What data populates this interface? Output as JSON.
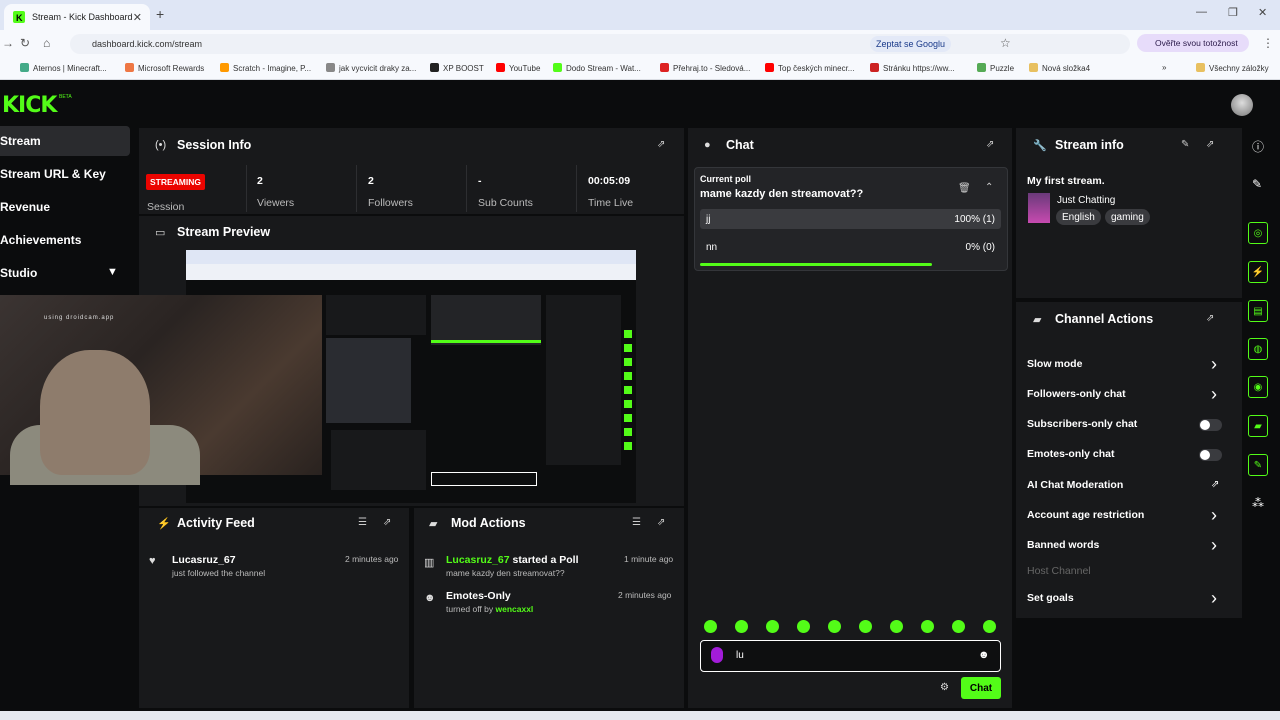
{
  "browser": {
    "tab_title": "Stream - Kick Dashboard",
    "url": "dashboard.kick.com/stream",
    "translate_label": "Zeptat se Googlu",
    "profile_label": "Ověřte svou totožnost",
    "bookmarks": [
      "Aternos | Minecraft...",
      "Microsoft Rewards",
      "Scratch - Imagine, P...",
      "jak vycvicit draky za...",
      "XP BOOST",
      "YouTube",
      "Dodo Stream - Wat...",
      "Přehraj.to - Sledová...",
      "Top českých minecr...",
      "Stránku https://ww...",
      "Puzzle",
      "Nová složka4"
    ],
    "bookmarks_all": "Všechny záložky"
  },
  "header": {
    "logo": "KICK",
    "beta": "BETA"
  },
  "sidebar": {
    "items": [
      {
        "label": "Stream"
      },
      {
        "label": "Stream URL & Key"
      },
      {
        "label": "Revenue"
      },
      {
        "label": "Achievements"
      },
      {
        "label": "Studio"
      }
    ]
  },
  "session": {
    "title": "Session Info",
    "badge": "STREAMING",
    "session_label": "Session",
    "stats": [
      {
        "value": "2",
        "label": "Viewers"
      },
      {
        "value": "2",
        "label": "Followers"
      },
      {
        "value": "-",
        "label": "Sub Counts"
      },
      {
        "value": "00:05:09",
        "label": "Time Live"
      }
    ]
  },
  "preview": {
    "title": "Stream Preview",
    "cam_text": "using droidcam.app"
  },
  "activity": {
    "title": "Activity Feed",
    "items": [
      {
        "user": "Lucasruz_67",
        "text": "just followed the channel",
        "time": "2 minutes ago"
      }
    ]
  },
  "mod": {
    "title": "Mod Actions",
    "items": [
      {
        "user": "Lucasruz_67",
        "action": "started a Poll",
        "sub": "mame kazdy den streamovat??",
        "time": "1 minute ago"
      },
      {
        "title": "Emotes-Only",
        "sub": "turned off by",
        "user": "wencaxxl",
        "time": "2 minutes ago"
      }
    ]
  },
  "chat": {
    "title": "Chat",
    "poll_label": "Current poll",
    "poll_question": "mame kazdy den streamovat??",
    "options": [
      {
        "text": "jj",
        "result": "100% (1)",
        "fraction": 1.0
      },
      {
        "text": "nn",
        "result": "0% (0)",
        "fraction": 0.0
      }
    ],
    "timer_fraction": 0.77,
    "input_value": "lu",
    "send_label": "Chat"
  },
  "stream_info": {
    "title": "Stream info",
    "stream_title": "My first stream.",
    "category": "Just Chatting",
    "tags": [
      "English",
      "gaming"
    ]
  },
  "channel_actions": {
    "title": "Channel Actions",
    "items": [
      {
        "label": "Slow mode",
        "control": "arrow"
      },
      {
        "label": "Followers-only chat",
        "control": "arrow"
      },
      {
        "label": "Subscribers-only chat",
        "control": "toggle"
      },
      {
        "label": "Emotes-only chat",
        "control": "toggle"
      },
      {
        "label": "AI Chat Moderation",
        "control": "external"
      },
      {
        "label": "Account age restriction",
        "control": "arrow"
      },
      {
        "label": "Banned words",
        "control": "arrow"
      },
      {
        "label": "Host Channel",
        "control": "none"
      },
      {
        "label": "Set goals",
        "control": "arrow"
      }
    ]
  },
  "colors": {
    "accent": "#53fc18",
    "streaming": "#eb0400",
    "panel": "#18191b",
    "bg": "#0b0c0d"
  }
}
